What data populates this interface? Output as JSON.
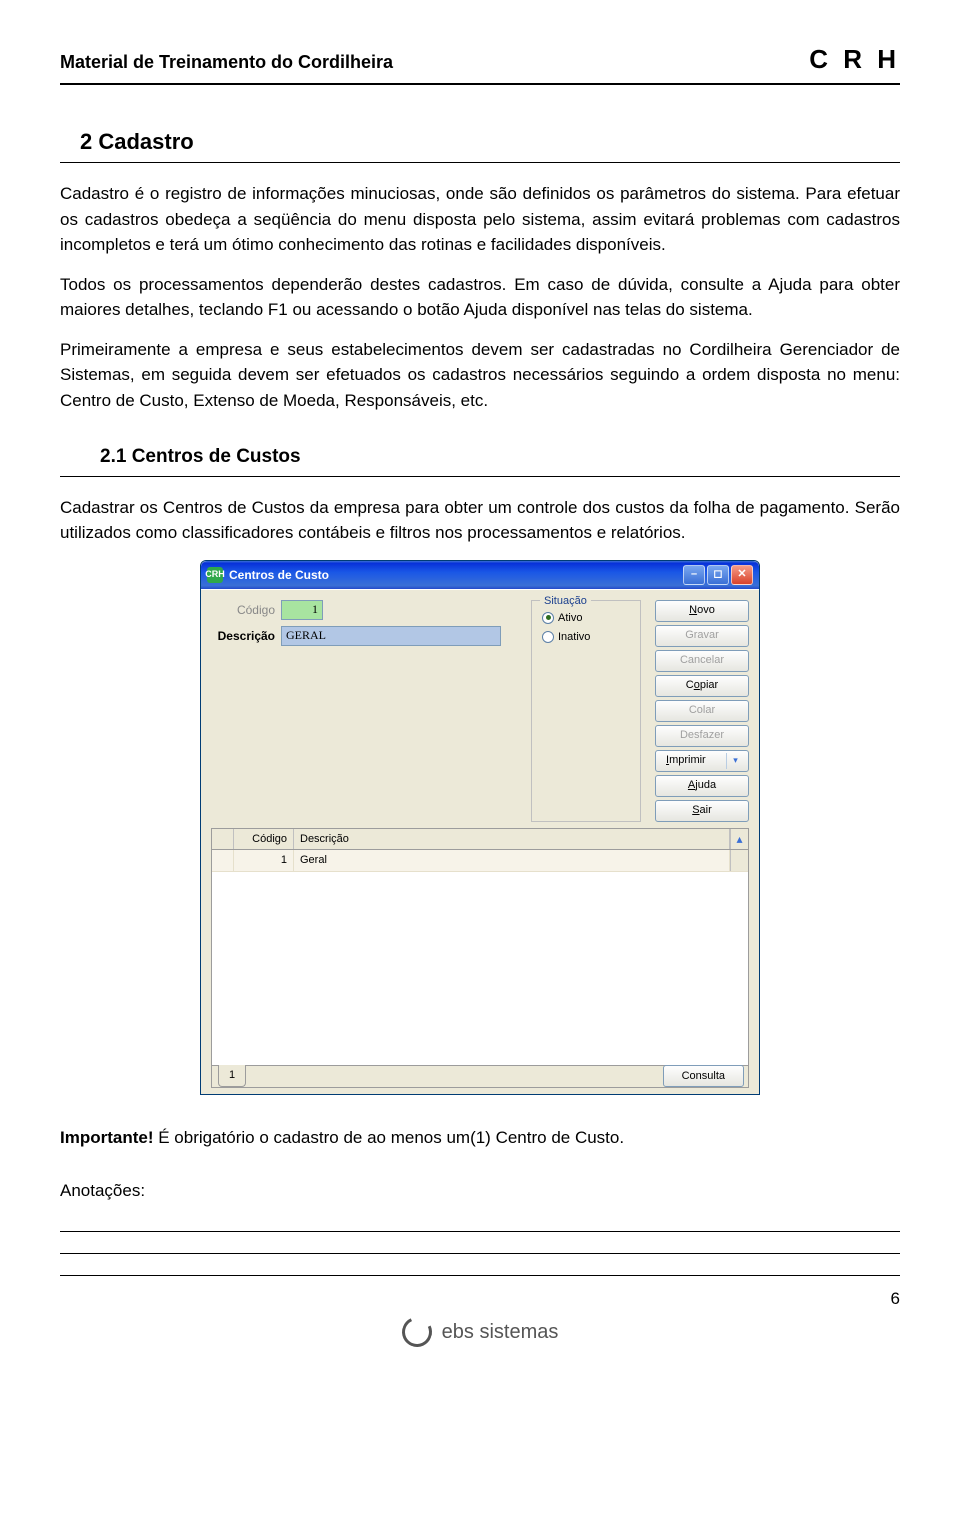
{
  "header": {
    "left": "Material de Treinamento do Cordilheira",
    "right": "C R H"
  },
  "section": {
    "title": "2 Cadastro"
  },
  "paragraphs": {
    "p1": "Cadastro é o registro de informações minuciosas, onde são definidos os parâmetros do sistema. Para efetuar os cadastros obedeça a seqüência do menu disposta pelo sistema, assim evitará problemas com cadastros incompletos e terá um ótimo conhecimento das rotinas e facilidades disponíveis.",
    "p2": "Todos os processamentos dependerão destes cadastros. Em caso de dúvida, consulte a Ajuda para obter maiores detalhes, teclando F1 ou acessando o botão Ajuda disponível nas telas do sistema.",
    "p3": "Primeiramente a empresa e seus estabelecimentos devem ser cadastradas no Cordilheira Gerenciador de Sistemas, em seguida devem ser efetuados os cadastros necessários seguindo a ordem disposta no menu: Centro de Custo, Extenso de Moeda, Responsáveis, etc."
  },
  "subsection": {
    "title": "2.1 Centros de Custos"
  },
  "sub_para": "Cadastrar os Centros de Custos da empresa para obter um controle dos custos da folha de pagamento. Serão utilizados como classificadores contábeis e filtros nos processamentos e relatórios.",
  "dialog": {
    "icon_text": "CRH",
    "title": "Centros de Custo",
    "labels": {
      "codigo": "Código",
      "descricao": "Descrição",
      "situacao": "Situação"
    },
    "values": {
      "codigo": "1",
      "descricao": "GERAL"
    },
    "radios": {
      "ativo": "Ativo",
      "inativo": "Inativo"
    },
    "buttons": {
      "novo": "Novo",
      "gravar": "Gravar",
      "cancelar": "Cancelar",
      "copiar": "Copiar",
      "colar": "Colar",
      "desfazer": "Desfazer",
      "imprimir": "Imprimir",
      "ajuda": "Ajuda",
      "sair": "Sair"
    },
    "grid": {
      "headers": {
        "codigo": "Código",
        "descricao": "Descrição"
      },
      "row1": {
        "codigo": "1",
        "descricao": "Geral"
      }
    },
    "tab": "1",
    "consulta": "Consulta"
  },
  "important": {
    "label": "Importante!",
    "text": " É obrigatório o cadastro de ao menos um(1) Centro de Custo."
  },
  "notes": {
    "label": "Anotações:"
  },
  "page_number": "6",
  "footer_brand": "ebs sistemas"
}
